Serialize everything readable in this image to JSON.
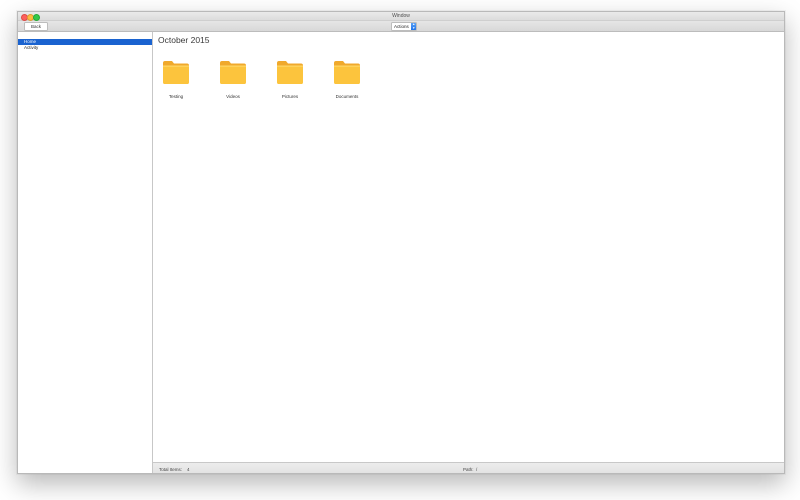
{
  "window": {
    "title": "Window"
  },
  "toolbar": {
    "back_label": "Back",
    "actions_label": "Actions"
  },
  "sidebar": {
    "items": [
      {
        "label": "Home",
        "selected": true
      },
      {
        "label": "Activity",
        "selected": false
      }
    ]
  },
  "main": {
    "heading": "October 2015",
    "folders": [
      {
        "name": "Testing",
        "icon": "folder-icon"
      },
      {
        "name": "Videos",
        "icon": "folder-icon"
      },
      {
        "name": "Pictures",
        "icon": "folder-icon"
      },
      {
        "name": "Documents",
        "icon": "folder-icon"
      }
    ]
  },
  "statusbar": {
    "total_label": "Total Items:",
    "total_value": "4",
    "path_label": "Path:",
    "path_value": "/"
  },
  "colors": {
    "selection": "#1a63d0",
    "folder_body": "#fcc43d",
    "folder_tab": "#f0a92c",
    "accent": "#1f74ea"
  }
}
